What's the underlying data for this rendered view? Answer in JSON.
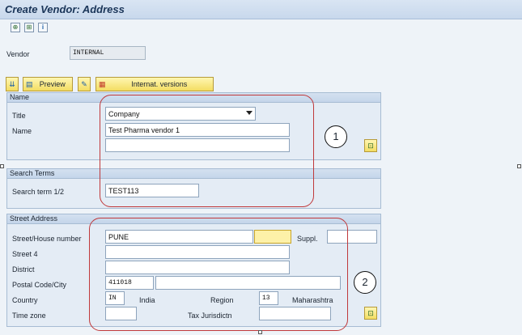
{
  "window": {
    "title": "Create Vendor: Address"
  },
  "toolbar": {
    "icons": [
      "new-entry-icon",
      "copy-entry-icon",
      "info-icon"
    ],
    "glyphs": [
      "⊕",
      "⊞",
      "i"
    ]
  },
  "header": {
    "vendor_label": "Vendor",
    "vendor_value": "INTERNAL"
  },
  "app_toolbar": {
    "collapse_glyph": "⇊",
    "preview_label": "Preview",
    "preview_glyph": "▤",
    "lock_glyph": "✎",
    "internat_label": "Internat. versions",
    "internat_glyph": "▦"
  },
  "name_group": {
    "heading": "Name",
    "title_label": "Title",
    "title_value": "Company",
    "name_label": "Name",
    "name_value": "Test Pharma vendor 1",
    "name2_value": ""
  },
  "search_group": {
    "heading": "Search Terms",
    "term_label": "Search term 1/2",
    "term_value": "TEST113"
  },
  "street_group": {
    "heading": "Street Address",
    "street_label": "Street/House number",
    "street_value": "PUNE",
    "house_value": "",
    "suppl_label": "Suppl.",
    "suppl_value": "",
    "street4_label": "Street 4",
    "street4_value": "",
    "district_label": "District",
    "district_value": "",
    "postal_label": "Postal Code/City",
    "postal_value": "411018",
    "city_value": "",
    "country_label": "Country",
    "country_value": "IN",
    "country_name": "India",
    "region_label": "Region",
    "region_value": "13",
    "region_name": "Maharashtra",
    "timezone_label": "Time zone",
    "timezone_value": "",
    "taxjur_label": "Tax Jurisdictn",
    "taxjur_value": ""
  },
  "annotations": {
    "marker1": "1",
    "marker2": "2"
  },
  "side_buttons": {
    "glyph": "⊡"
  }
}
